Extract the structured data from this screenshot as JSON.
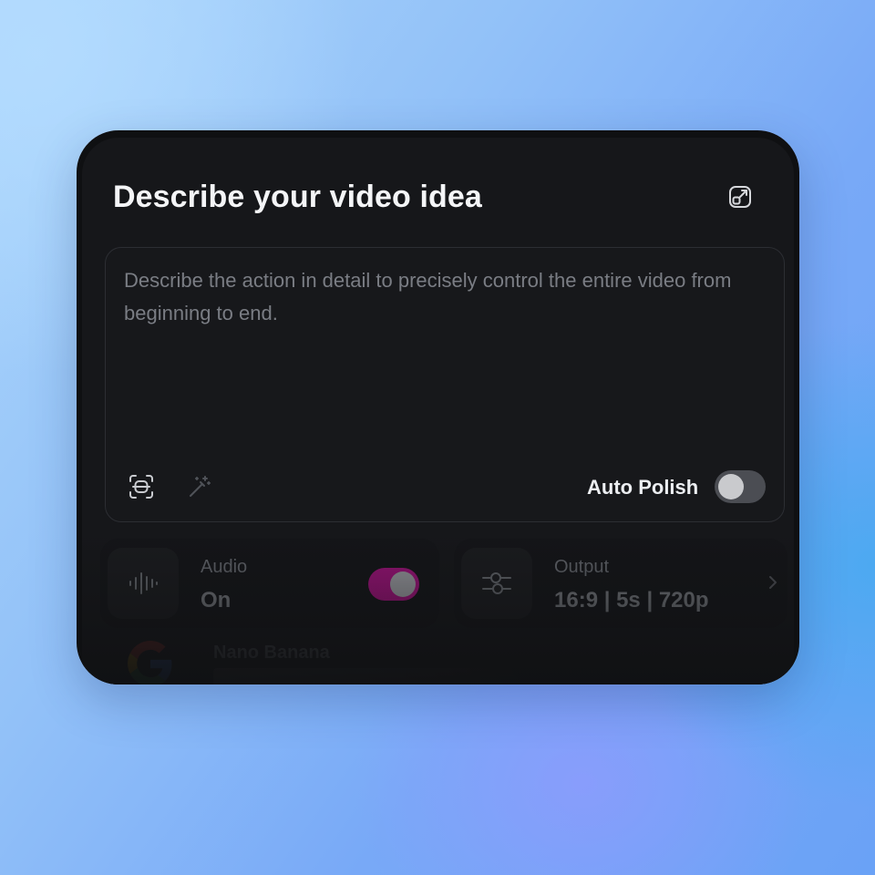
{
  "header": {
    "title": "Describe your video idea",
    "expand_icon": "expand-icon"
  },
  "prompt": {
    "value": "",
    "placeholder": "Describe the action in detail to precisely control the entire video from beginning to end.",
    "scan_icon": "scan-icon",
    "wand_icon": "magic-wand-icon",
    "auto_polish_label": "Auto Polish",
    "auto_polish_enabled": false
  },
  "audio": {
    "label": "Audio",
    "value": "On",
    "enabled": true,
    "icon": "waveform-icon"
  },
  "output": {
    "label": "Output",
    "value": "16:9 | 5s | 720p",
    "icon": "sliders-icon",
    "chevron_icon": "chevron-right-icon"
  },
  "model": {
    "name": "Nano Banana",
    "icon": "google-icon"
  },
  "colors": {
    "card_bg": "#0f1012",
    "accent_toggle": "#a1127c",
    "toggle_off": "#4b4d53"
  }
}
